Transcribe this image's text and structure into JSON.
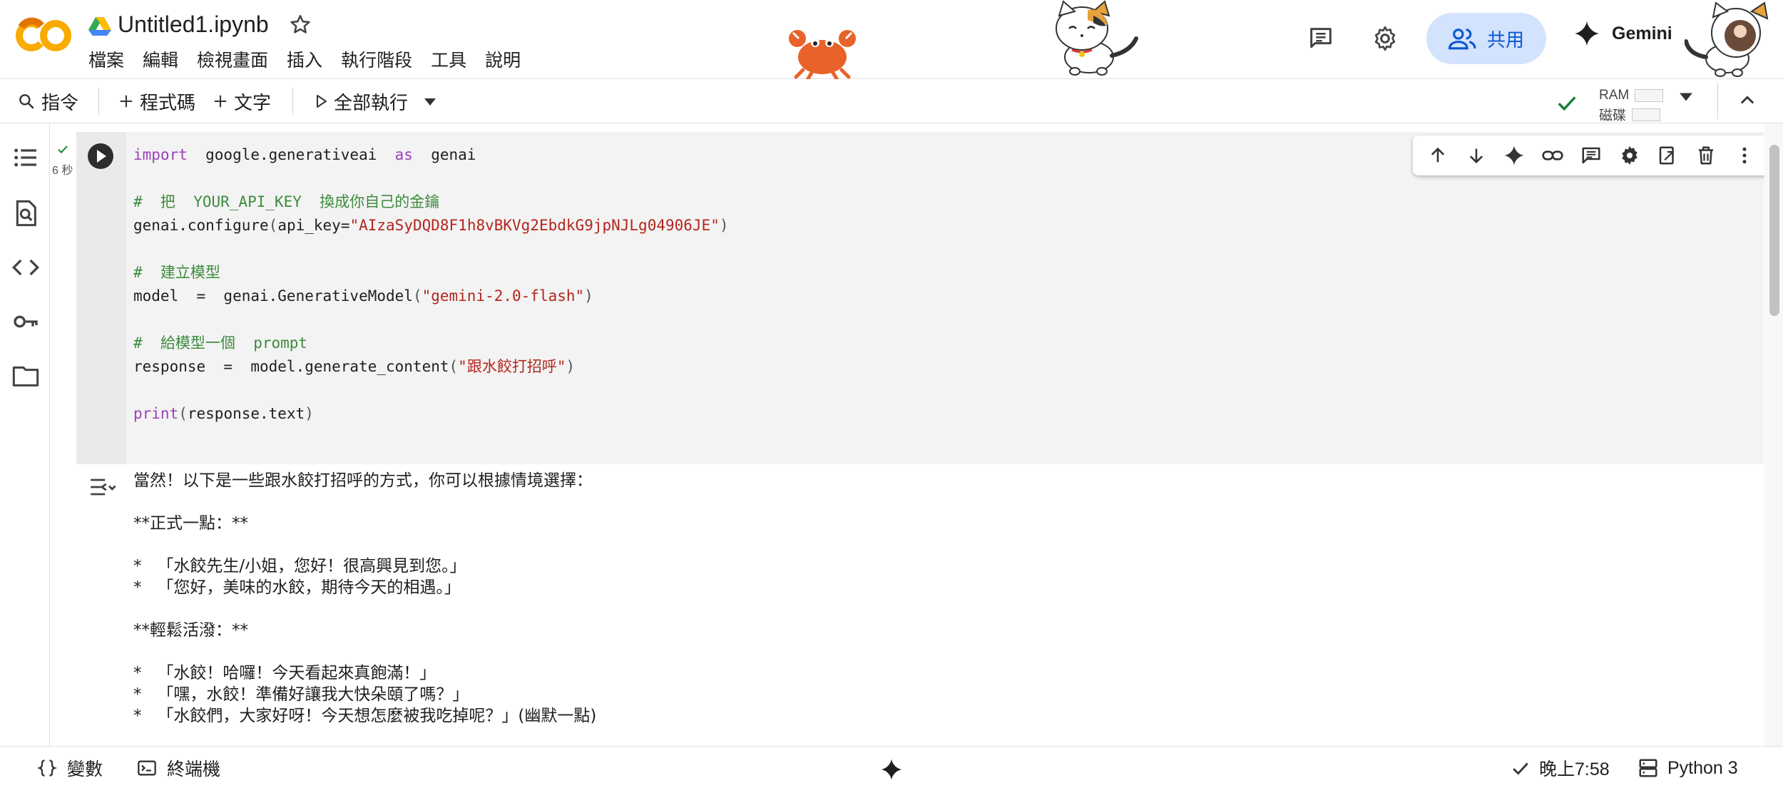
{
  "header": {
    "title": "Untitled1.ipynb",
    "logo_text": "CO",
    "menu": [
      "檔案",
      "編輯",
      "檢視畫面",
      "插入",
      "執行階段",
      "工具",
      "說明"
    ],
    "share_label": "共用",
    "gemini_label": "Gemini"
  },
  "toolbar": {
    "commands_label": "指令",
    "add_code_label": "程式碼",
    "add_text_label": "文字",
    "run_all_label": "全部執行",
    "ram_label": "RAM",
    "disk_label": "磁碟"
  },
  "cell": {
    "exec_time": "6 秒",
    "code_lines": [
      "import google.generativeai as genai",
      "",
      "# 把 YOUR_API_KEY 換成你自己的金鑰",
      "genai.configure(api_key=\"AIzaSyDQD8F1h8vBKVg2EbdkG9jpNJLg04906JE\")",
      "",
      "# 建立模型",
      "model = genai.GenerativeModel(\"gemini-2.0-flash\")",
      "",
      "# 給模型一個 prompt",
      "response = model.generate_content(\"跟水餃打招呼\")",
      "",
      "print(response.text)"
    ]
  },
  "output": {
    "lines": [
      "當然！以下是一些跟水餃打招呼的方式，你可以根據情境選擇：",
      "",
      "**正式一點：**",
      "",
      "*   「水餃先生/小姐，您好！很高興見到您。」",
      "*   「您好，美味的水餃，期待今天的相遇。」",
      "",
      "**輕鬆活潑：**",
      "",
      "*   「水餃！哈囉！今天看起來真飽滿！」",
      "*   「嘿，水餃！準備好讓我大快朵頤了嗎？」",
      "*   「水餃們，大家好呀！今天想怎麼被我吃掉呢？」(幽默一點)"
    ]
  },
  "statusbar": {
    "variables_label": "變數",
    "terminal_label": "終端機",
    "time_label": "晚上7:58",
    "runtime_label": "Python 3"
  },
  "colors": {
    "accent": "#0b57d0",
    "share_bg": "#d3e3fd",
    "logo_orange": "#f9ab00",
    "check_green": "#188038"
  },
  "icons": [
    "drive-icon",
    "star-icon",
    "comments-icon",
    "settings-icon",
    "people-icon",
    "gemini-icon",
    "search-icon",
    "plus-icon",
    "play-icon",
    "chevron-down-icon",
    "check-icon",
    "chevron-up-icon",
    "toc-icon",
    "find-icon",
    "code-icon",
    "key-icon",
    "folder-icon",
    "arrow-up-icon",
    "arrow-down-icon",
    "link-icon",
    "comment-icon",
    "gear-icon",
    "mirror-icon",
    "trash-icon",
    "more-vert-icon",
    "output-icon",
    "braces-icon",
    "terminal-icon",
    "server-icon"
  ]
}
